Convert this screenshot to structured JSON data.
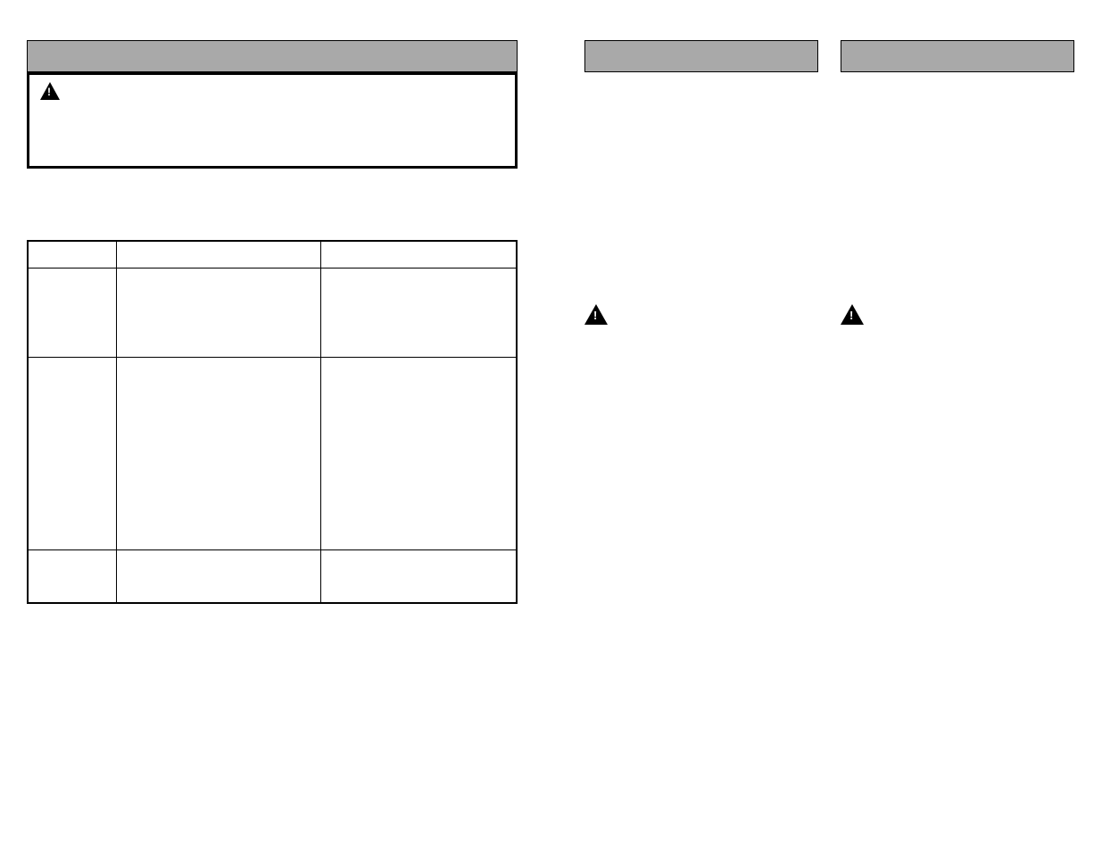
{
  "left": {
    "header": "",
    "warning_text": "",
    "table": {
      "headers": [
        "",
        "",
        ""
      ],
      "rows": [
        [
          "",
          "",
          ""
        ],
        [
          "",
          "",
          ""
        ],
        [
          "",
          "",
          ""
        ]
      ]
    }
  },
  "right": {
    "col1": {
      "header": "",
      "warning_text": ""
    },
    "col2": {
      "header": "",
      "warning_text": ""
    }
  }
}
